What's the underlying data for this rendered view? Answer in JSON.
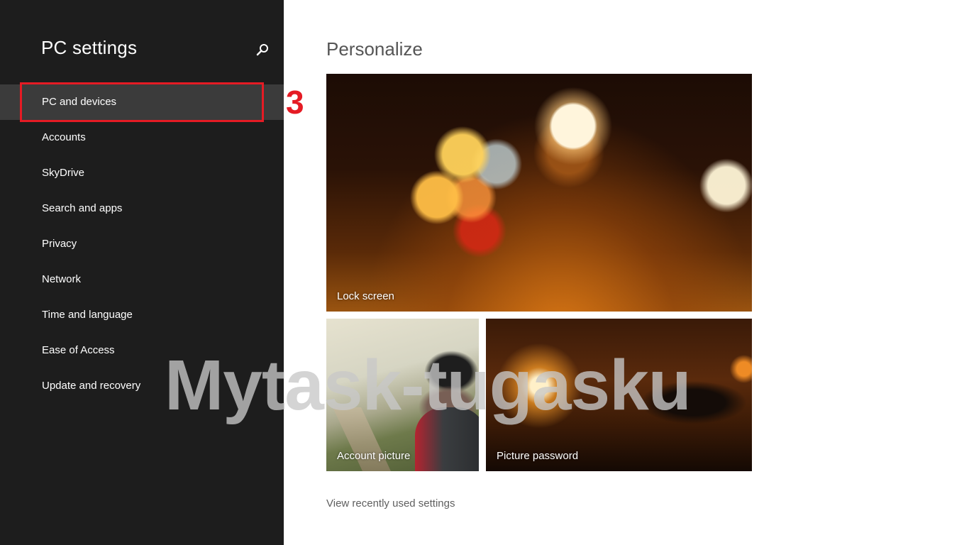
{
  "sidebar": {
    "title": "PC settings",
    "search_icon": "search-icon",
    "items": [
      {
        "label": "PC and devices",
        "selected": true
      },
      {
        "label": "Accounts",
        "selected": false
      },
      {
        "label": "SkyDrive",
        "selected": false
      },
      {
        "label": "Search and apps",
        "selected": false
      },
      {
        "label": "Privacy",
        "selected": false
      },
      {
        "label": "Network",
        "selected": false
      },
      {
        "label": "Time and language",
        "selected": false
      },
      {
        "label": "Ease of Access",
        "selected": false
      },
      {
        "label": "Update and recovery",
        "selected": false
      }
    ]
  },
  "annotation": {
    "step": "3",
    "color": "#e51b24"
  },
  "main": {
    "title": "Personalize",
    "tiles": {
      "lock_screen": "Lock screen",
      "account_picture": "Account picture",
      "picture_password": "Picture password"
    },
    "recent_link": "View recently used settings"
  },
  "watermark": "Mytask-tugasku",
  "colors": {
    "sidebar_bg": "#1d1d1d",
    "selected_bg": "#3b3b3b",
    "page_bg": "#ffffff"
  }
}
